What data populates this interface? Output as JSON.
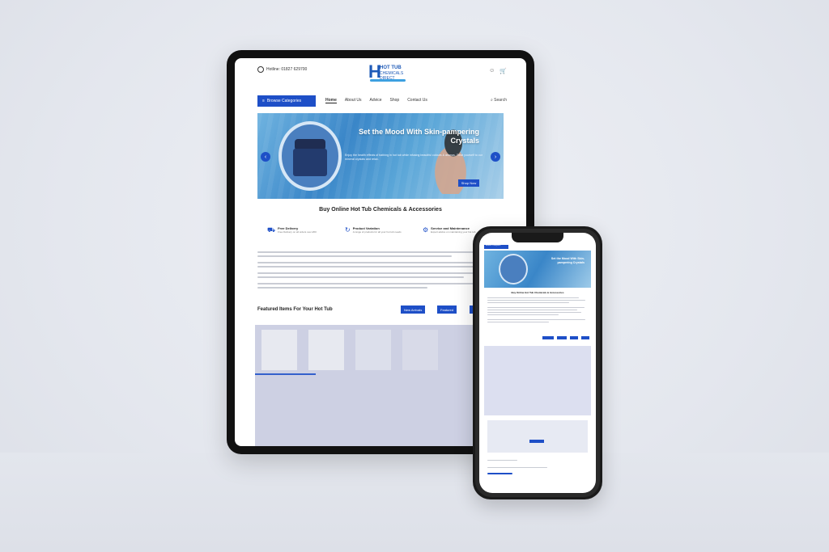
{
  "tablet": {
    "contact": "Hotline: 01827 629700",
    "logo": {
      "line1": "HOT TUB",
      "line2": "CHEMICALS DIRECT"
    },
    "browse_label": "Browse Categories",
    "menu": [
      "Home",
      "About Us",
      "Advice",
      "Shop",
      "Contact Us"
    ],
    "active_menu": "Home",
    "search_label": "Search",
    "hero": {
      "title": "Set the Mood With Skin-pampering Crystals",
      "text": "Enjoy the health effects of bathing in hot tub while infusing beautiful colours & aromas. Treat yourself to our mineral crystals and relax.",
      "button": "Shop Now"
    },
    "section_title": "Buy Online Hot Tub Chemicals & Accessories",
    "features": [
      {
        "icon": "truck-icon",
        "title": "Free Delivery",
        "desc": "Free Delivery on all orders over £50"
      },
      {
        "icon": "refresh-icon",
        "title": "Product Variation",
        "desc": "A range of products for all your hot tub needs"
      },
      {
        "icon": "tools-icon",
        "title": "Service and Maintenance",
        "desc": "Expert advice on maintaining your hot tub"
      }
    ],
    "featured_title": "Featured Items For Your Hot Tub",
    "filters": [
      "New Arrivals",
      "Featured",
      "Top"
    ]
  },
  "phone": {
    "browse_label": "Browse Categories",
    "hero_title": "Set the Mood With Skin-pampering Crystals",
    "section_title": "Buy Online Hot Tub Chemicals & Accessories"
  },
  "colors": {
    "accent": "#1e4fc7",
    "hero": "#3a86c8"
  }
}
